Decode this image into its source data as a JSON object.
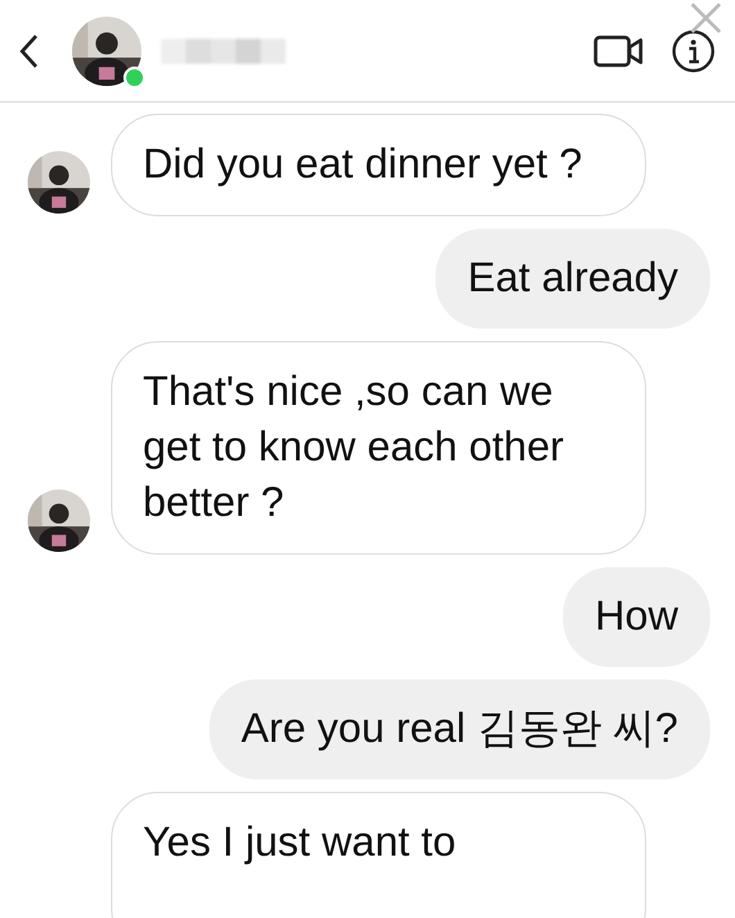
{
  "header": {
    "online": true
  },
  "messages": [
    {
      "kind": "incoming",
      "text": "Did you eat dinner yet ?",
      "avatar": true
    },
    {
      "kind": "outgoing",
      "text": "Eat already"
    },
    {
      "kind": "incoming",
      "text": "That's nice ,so can we get to know each other better ?",
      "avatar": true
    },
    {
      "kind": "outgoing",
      "text": "How"
    },
    {
      "kind": "outgoing",
      "text": "Are you real 김동완 씨?"
    },
    {
      "kind": "incoming",
      "text": "Yes I just want to",
      "avatar": false
    }
  ]
}
